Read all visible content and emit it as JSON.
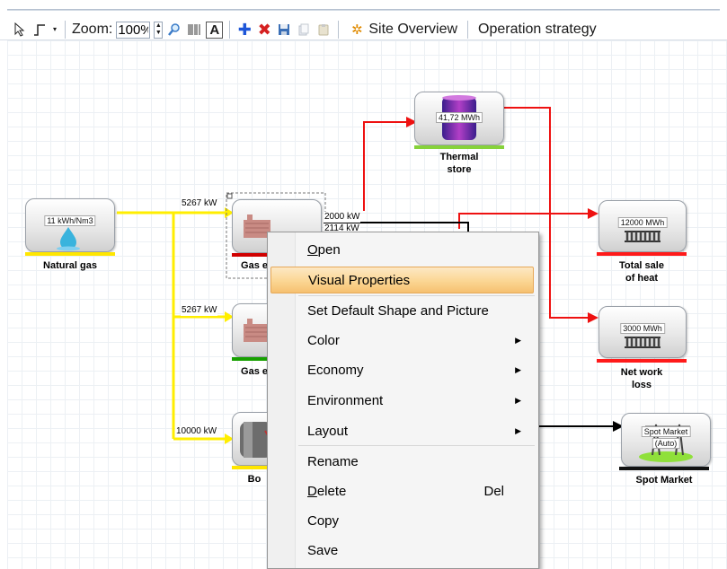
{
  "toolbar": {
    "zoom_label": "Zoom:",
    "zoom_value": "100%",
    "font_glyph": "A",
    "site_overview_label": "Site Overview",
    "operation_strategy_label": "Operation strategy",
    "icons": [
      "pointer-icon",
      "connector-icon",
      "dropdown-arrow-icon",
      "spin-icon",
      "magnifier-icon",
      "barcode-icon",
      "font-icon",
      "add-icon",
      "delete-icon",
      "save-icon",
      "copy-icon",
      "paste-icon",
      "site-overview-icon"
    ],
    "colors": {
      "add": "#1e56d8",
      "delete": "#d52020"
    }
  },
  "nodes": {
    "natural_gas": {
      "value": "11 kWh/Nm3",
      "label": "Natural gas",
      "bar_color": "#ffe600"
    },
    "gas_engine_1": {
      "label_partial": "Gas e",
      "bar_color": "#d00000"
    },
    "gas_engine_2": {
      "label_partial": "Gas e",
      "bar_color": "#17a000"
    },
    "boiler": {
      "label_partial": "Bo",
      "bar_color": "#ffe600"
    },
    "thermal_store": {
      "value": "41,72 MWh",
      "label_line1": "Thermal",
      "label_line2": "store",
      "bar_color": "#86d23a"
    },
    "total_sale": {
      "value": "12000 MWh",
      "label_line1": "Total sale",
      "label_line2": "of heat",
      "bar_color": "#ff1a1a"
    },
    "net_work_loss": {
      "value": "3000 MWh",
      "label_line1": "Net work",
      "label_line2": "loss",
      "bar_color": "#ff1a1a"
    },
    "spot_market": {
      "value_line1": "Spot Market",
      "value_line2": "(Auto)",
      "label": "Spot Market",
      "bar_color": "#111111"
    }
  },
  "flows": {
    "f1": "5267 kW",
    "f2": "5267 kW",
    "f3": "10000 kW",
    "f4": "2000 kW",
    "f5": "2114 kW"
  },
  "colors": {
    "gas_line": "#ffee00",
    "heat_line": "#ee1111",
    "power_line": "#000000"
  },
  "menu": {
    "open": {
      "text": "Open",
      "underline_letter": "O",
      "rest": "pen"
    },
    "visual_properties": "Visual Properties",
    "set_default": "Set Default Shape and Picture",
    "color": "Color",
    "economy": "Economy",
    "environment": "Environment",
    "layout": "Layout",
    "rename": "Rename",
    "delete": {
      "underline_letter": "D",
      "rest": "elete",
      "shortcut": "Del"
    },
    "copy": "Copy",
    "save": "Save",
    "highlight_color": "#fbd693"
  }
}
